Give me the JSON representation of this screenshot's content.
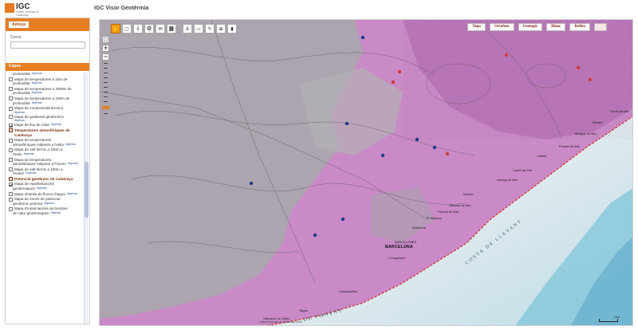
{
  "header": {
    "logo_text": "IGC",
    "logo_subtitle": "Institut Geològic de Catalunya",
    "app_title": "IGC Visor Geotèrmia"
  },
  "sidebar": {
    "search_tab": "Adreça",
    "search_label": "Cerca:",
    "search_value": "",
    "layers_title": "Capes",
    "legend_text": "llegenda",
    "layers": [
      {
        "kind": "cont",
        "text": "profunditat",
        "legend": true
      },
      {
        "kind": "item",
        "checked": false,
        "text": "Mapa de temperatures a 1km de",
        "legend": false
      },
      {
        "kind": "cont",
        "text": "profunditat",
        "legend": true
      },
      {
        "kind": "item",
        "checked": false,
        "text": "Mapa de temperatures a 2000m de",
        "legend": false
      },
      {
        "kind": "cont",
        "text": "profunditat",
        "legend": true
      },
      {
        "kind": "item",
        "checked": false,
        "text": "Mapa de temperatures a 100m de",
        "legend": false
      },
      {
        "kind": "cont",
        "text": "profunditat",
        "legend": true
      },
      {
        "kind": "item",
        "checked": false,
        "text": "Mapa de conductivitat tèrmica",
        "legend": false
      },
      {
        "kind": "cont",
        "text": "",
        "legend": true
      },
      {
        "kind": "item",
        "checked": false,
        "text": "Mapa de gradients geotèrmics",
        "legend": false
      },
      {
        "kind": "cont",
        "text": "",
        "legend": true
      },
      {
        "kind": "item",
        "checked": true,
        "text": "Mapa de flux de calor",
        "legend": true
      },
      {
        "kind": "group",
        "text": "Temperatures atmosfèriques de Catalunya"
      },
      {
        "kind": "item",
        "checked": false,
        "text": "Mapa de temperatures",
        "legend": false
      },
      {
        "kind": "cont",
        "text": "atmosfèriques mitjanes a l'estiu",
        "legend": true
      },
      {
        "kind": "item",
        "checked": false,
        "text": "Mapa de salt tèrmic a 100m a",
        "legend": false
      },
      {
        "kind": "cont",
        "text": "l'estiu",
        "legend": true
      },
      {
        "kind": "item",
        "checked": false,
        "text": "Mapa de temperatures",
        "legend": false
      },
      {
        "kind": "cont",
        "text": "atmosfèriques mitjanes a l'hivern",
        "legend": true
      },
      {
        "kind": "item",
        "checked": false,
        "text": "Mapa de salt tèrmic a 100m a",
        "legend": false
      },
      {
        "kind": "cont",
        "text": "l'hivern",
        "legend": true
      },
      {
        "kind": "group",
        "text": "Potencial geotèrmic de Catalunya"
      },
      {
        "kind": "item",
        "checked": true,
        "text": "Mapa de manifestacions",
        "legend": false
      },
      {
        "kind": "cont",
        "text": "geotèrmiques",
        "legend": true
      },
      {
        "kind": "item",
        "checked": false,
        "text": "Mapa síntesis de fluxos d'aigua",
        "legend": true
      },
      {
        "kind": "item",
        "checked": false,
        "text": "Mapa de zones de potencial",
        "legend": false
      },
      {
        "kind": "cont",
        "text": "geotèrmic profund",
        "legend": true
      },
      {
        "kind": "item",
        "checked": false,
        "text": "Mapa d'instal·lacions de bombes",
        "legend": false
      },
      {
        "kind": "cont",
        "text": "de calor geotèrmiques",
        "legend": true
      }
    ]
  },
  "map": {
    "basemaps": [
      "Topo",
      "Ortofoto",
      "Geologic",
      "Blanc",
      "Relleu"
    ],
    "attribution": "Institut Geològic de Catalunya 2010",
    "scale_text": "2 km",
    "labels": [
      {
        "name": "label-barcelona",
        "text": "BARCELONA",
        "cls": "city"
      },
      {
        "name": "label-barcelona-sub",
        "text": "BARCELONÈS",
        "cls": ""
      },
      {
        "name": "label-mataro",
        "text": "Mataró",
        "cls": ""
      },
      {
        "name": "label-vilanova",
        "text": "Vilanova i la Geltrú",
        "cls": ""
      },
      {
        "name": "label-costa",
        "text": "COSTA DE LLEVANT",
        "cls": "sea"
      },
      {
        "name": "label-ponent",
        "text": "DE PONENT",
        "cls": "sea"
      },
      {
        "name": "label-premia",
        "text": "Premià de Mar",
        "cls": ""
      },
      {
        "name": "label-masnou",
        "text": "El Masnou",
        "cls": ""
      },
      {
        "name": "label-badalona",
        "text": "Badalona",
        "cls": ""
      },
      {
        "name": "label-vilassar",
        "text": "Vilassar de Mar",
        "cls": ""
      },
      {
        "name": "label-malgrat",
        "text": "Malgrat de Mar",
        "cls": ""
      },
      {
        "name": "label-pineda",
        "text": "Pineda de Mar",
        "cls": ""
      },
      {
        "name": "label-calella",
        "text": "Calella",
        "cls": ""
      },
      {
        "name": "label-blanes",
        "text": "Blanes",
        "cls": ""
      },
      {
        "name": "label-arenys",
        "text": "Arenys de Mar",
        "cls": ""
      },
      {
        "name": "label-canet",
        "text": "Canet de Mar",
        "cls": ""
      },
      {
        "name": "label-sitges",
        "text": "Sitges",
        "cls": ""
      },
      {
        "name": "label-castelldefels",
        "text": "Castelldefels",
        "cls": ""
      },
      {
        "name": "label-hospitalet",
        "text": "L'Hospitalet",
        "cls": ""
      },
      {
        "name": "label-lloret",
        "text": "Lloret de Mar",
        "cls": ""
      }
    ]
  },
  "colors": {
    "accent": "#e67e22",
    "map_pink": "#c47fc0",
    "map_gray": "#a9a9ad",
    "sea_light": "#f2f2f2",
    "sea_blue": "#7fc6da"
  },
  "icons": {
    "toolbar": [
      "pan-icon",
      "select-icon",
      "info-icon",
      "print-icon",
      "email-icon",
      "link-icon",
      "measure-line-icon",
      "measure-area-icon",
      "draw-icon",
      "layers-icon",
      "legend-icon"
    ]
  }
}
